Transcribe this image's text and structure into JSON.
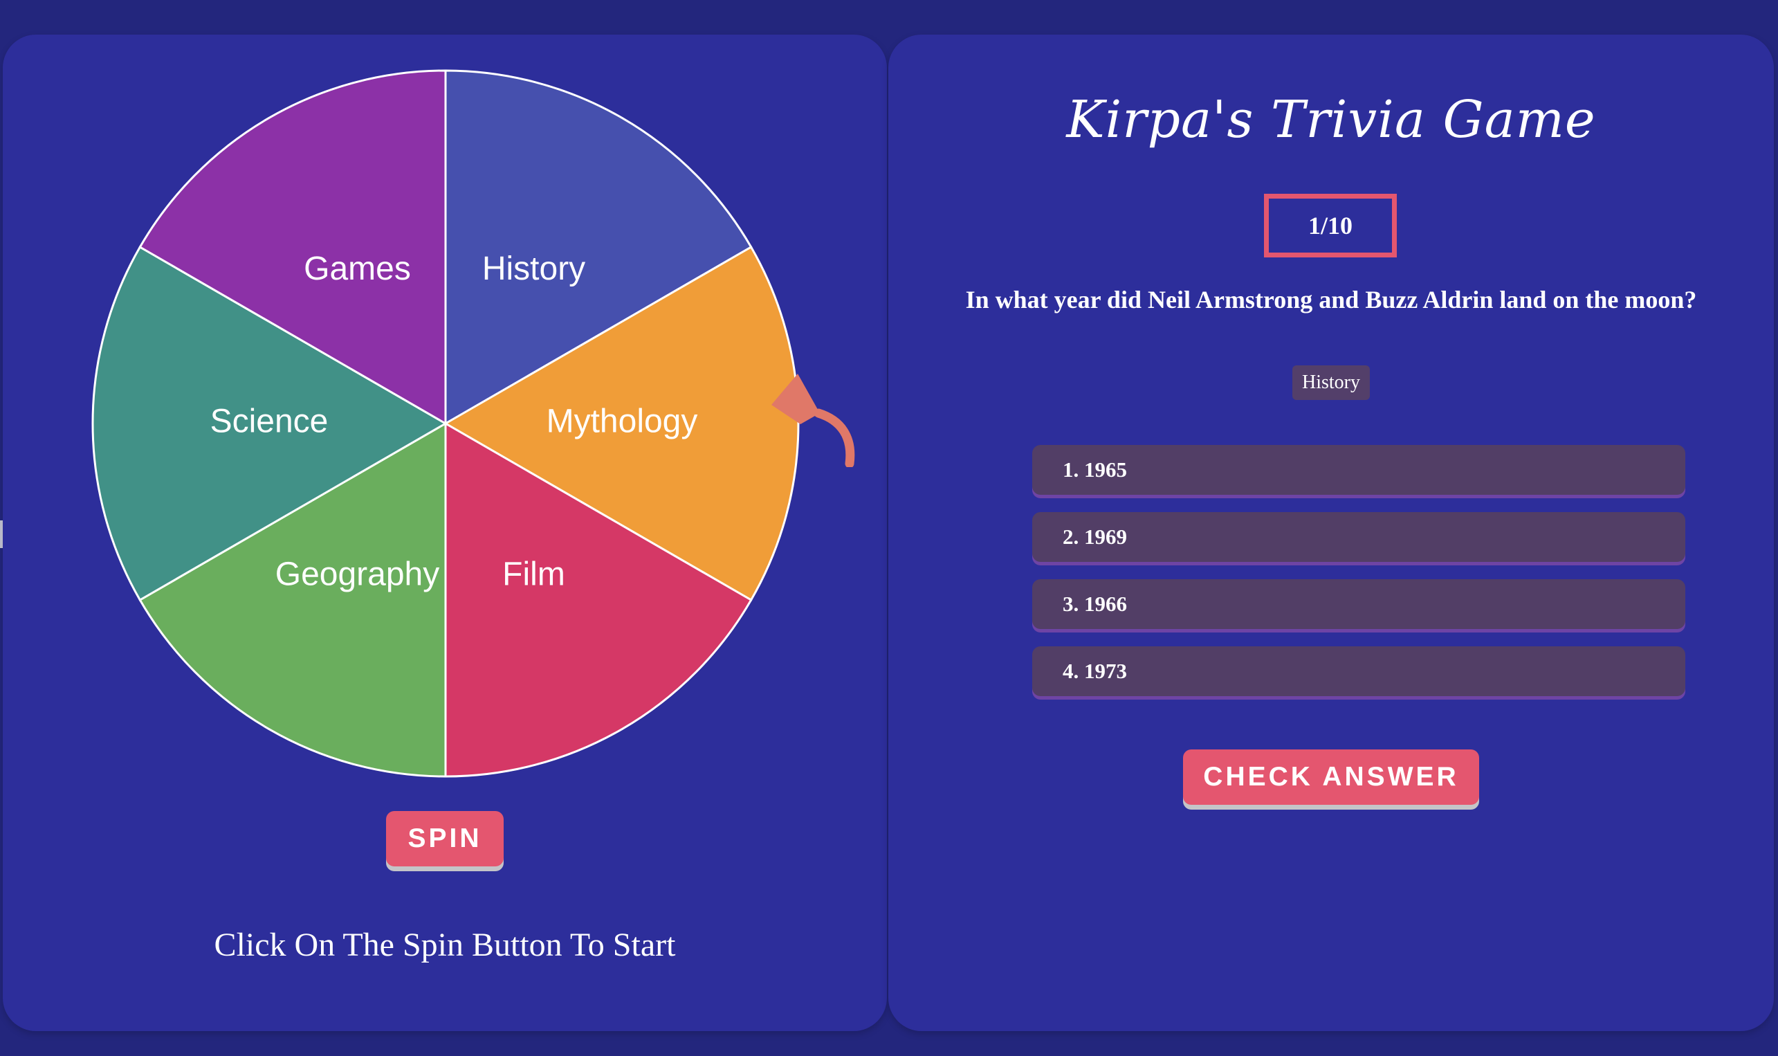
{
  "wheel": {
    "segments": [
      {
        "label": "History",
        "color": "#4650ae"
      },
      {
        "label": "Mythology",
        "color": "#f09d38"
      },
      {
        "label": "Film",
        "color": "#d53866"
      },
      {
        "label": "Geography",
        "color": "#6aae5d"
      },
      {
        "label": "Science",
        "color": "#419187"
      },
      {
        "label": "Games",
        "color": "#8c31a7"
      }
    ],
    "pointer_color": "#e07868",
    "spin_label": "SPIN",
    "instruction": "Click On The Spin Button To Start"
  },
  "game": {
    "title": "Kirpa's Trivia Game",
    "progress": "1/10",
    "question": "In what year did Neil Armstrong and Buzz Aldrin land on the moon?",
    "category": "History",
    "answers": [
      "1. 1965",
      "2. 1969",
      "3. 1966",
      "4. 1973"
    ],
    "check_label": "CHECK ANSWER"
  },
  "colors": {
    "background": "#23267d",
    "panel": "#2d2e9b",
    "accent": "#e4566f",
    "answer_bg": "#523e66"
  }
}
